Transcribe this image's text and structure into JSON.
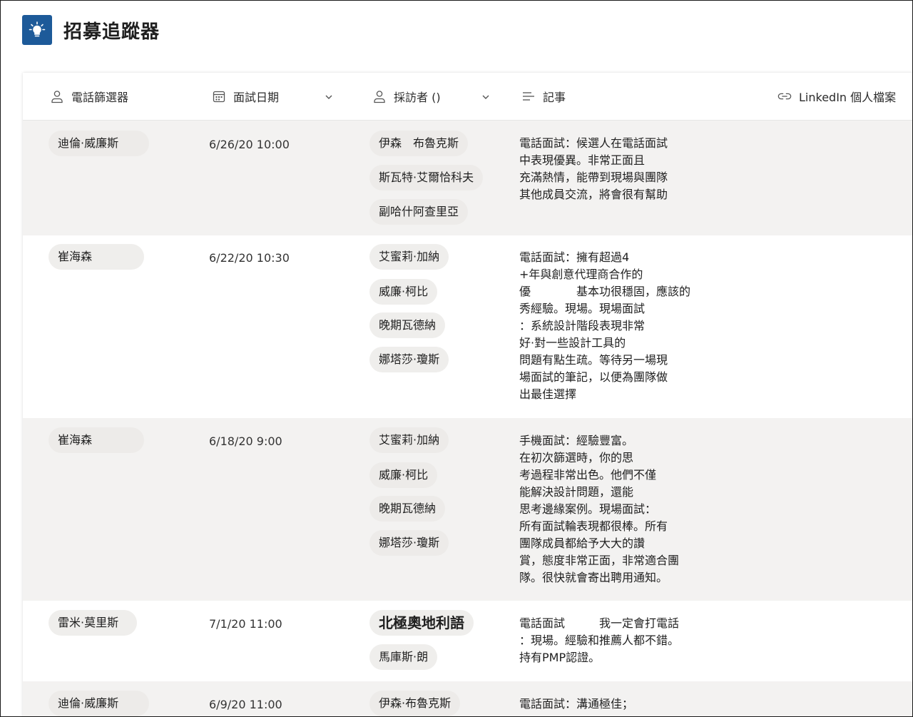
{
  "app": {
    "title": "招募追蹤器",
    "logo_icon": "lightbulb-icon",
    "accent": "#1d5a99"
  },
  "columns": [
    {
      "label": "電話篩選器",
      "icon": "person-icon",
      "dropdown": false
    },
    {
      "label": "面試日期",
      "icon": "calendar-icon",
      "dropdown": true
    },
    {
      "label": "採訪者 ()",
      "icon": "person-icon",
      "dropdown": true
    },
    {
      "label": "記事",
      "icon": "notes-lines-icon",
      "dropdown": false
    },
    {
      "label": "LinkedIn 個人檔案",
      "icon": "link-icon",
      "dropdown": false
    }
  ],
  "rows": [
    {
      "screener": "迪倫·威廉斯",
      "date": "6/26/20 10:00",
      "interviewers": [
        "伊森　布魯克斯",
        "斯瓦特·艾爾恰科夫",
        "副哈什阿查里亞"
      ],
      "notes": "電話面試：候選人在電話面試\n中表現優異。非常正面且\n充滿熱情，能帶到現場與團隊\n其他成員交流，將會很有幫助"
    },
    {
      "screener": "崔海森",
      "date": "6/22/20 10:30",
      "interviewers": [
        "艾蜜莉·加納",
        "威廉·柯比",
        "晚期瓦德納",
        "娜塔莎·瓊斯"
      ],
      "notes": "電話面試：擁有超過4\n+年與創意代理商合作的\n優　　　　基本功很穩固，應該的\n秀經驗。現場。現場面試\n：系統設計階段表現非常\n好·對一些設計工具的\n問題有點生疏。等待另一場現\n場面試的筆記，以便為團隊做\n出最佳選擇"
    },
    {
      "screener": "崔海森",
      "date": "6/18/20 9:00",
      "interviewers": [
        "艾蜜莉·加納",
        "威廉·柯比",
        "晚期瓦德納",
        "娜塔莎·瓊斯"
      ],
      "notes": "手機面試：經驗豐富。\n在初次篩選時，你的思\n考過程非常出色。他們不僅\n能解決設計問題，還能\n思考邊緣案例。現場面試：\n所有面試輪表現都很棒。所有\n團隊成員都給予大大的讚\n賞，態度非常正面，非常適合團\n隊。很快就會寄出聘用通知。"
    },
    {
      "screener": "雷米·莫里斯",
      "date": "7/1/20 11:00",
      "interviewers": [
        "北極奧地利語",
        "馬庫斯·朗"
      ],
      "bold_first_interviewer": true,
      "notes": "電話面試　　　我一定會打電話\n：現場。經驗和推薦人都不錯。\n持有PMP認證。"
    },
    {
      "screener": "迪倫·威廉斯",
      "date": "6/9/20 11:00",
      "interviewers": [
        "伊森·布魯克斯"
      ],
      "notes": "電話面試：溝通極佳；"
    }
  ]
}
